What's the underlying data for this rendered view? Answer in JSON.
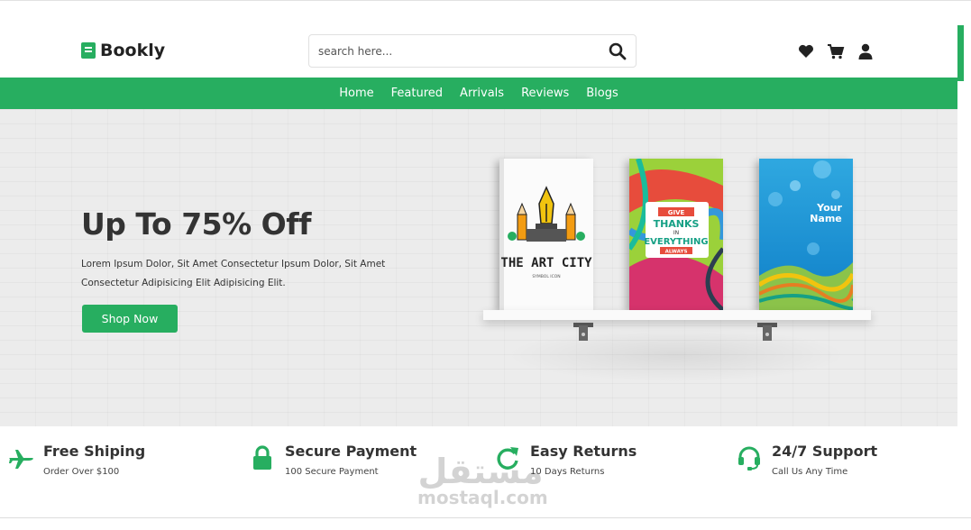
{
  "brand": {
    "name": "Bookly",
    "accent": "#27ae60"
  },
  "search": {
    "placeholder": "search here..."
  },
  "header_icons": [
    "heart-icon",
    "cart-icon",
    "user-icon"
  ],
  "nav": {
    "items": [
      {
        "label": "Home"
      },
      {
        "label": "Featured"
      },
      {
        "label": "Arrivals"
      },
      {
        "label": "Reviews"
      },
      {
        "label": "Blogs"
      }
    ]
  },
  "hero": {
    "title": "Up To 75% Off",
    "description": "Lorem Ipsum Dolor, Sit Amet Consectetur Ipsum Dolor, Sit Amet Consectetur Adipisicing Elit Adipisicing Elit.",
    "button": "Shop Now",
    "books": [
      {
        "title": "THE ART CITY",
        "subtitle": "SYMBOL ICON"
      },
      {
        "line1": "GIVE",
        "line2": "THANKS",
        "line3": "IN",
        "line4": "EVERYTHING",
        "line5": "ALWAYS"
      },
      {
        "line1": "Your",
        "line2": "Name"
      }
    ]
  },
  "features": [
    {
      "icon": "plane-icon",
      "title": "Free Shiping",
      "subtitle": "Order Over $100"
    },
    {
      "icon": "lock-icon",
      "title": "Secure Payment",
      "subtitle": "100 Secure Payment"
    },
    {
      "icon": "returns-icon",
      "title": "Easy Returns",
      "subtitle": "10 Days Returns"
    },
    {
      "icon": "headset-icon",
      "title": "24/7 Support",
      "subtitle": "Call Us Any Time"
    }
  ],
  "watermark": {
    "arabic": "مستقل",
    "latin": "mostaql.com"
  }
}
